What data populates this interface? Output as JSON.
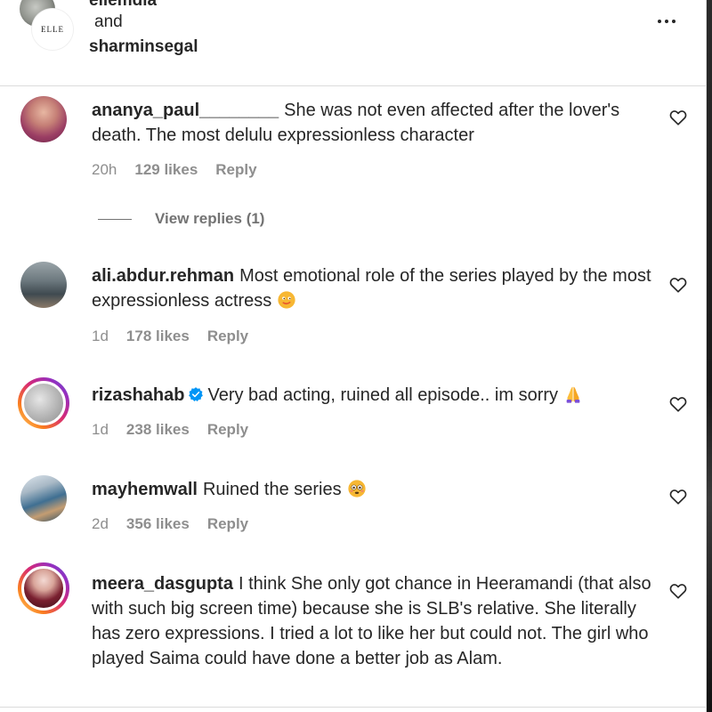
{
  "header": {
    "user1": "ellemdia",
    "and": "and",
    "user2": "sharminsegal",
    "logo_text": "ELLE"
  },
  "colors": {
    "text": "#262626",
    "secondary": "#8e8e8e",
    "verified": "#0095f6",
    "border": "#dbdbdb"
  },
  "comments": [
    {
      "username": "ananya_paul________",
      "text": "She was not even affected after the lover's death. The most delulu expressionless character",
      "time": "20h",
      "likes": "129 likes",
      "reply": "Reply",
      "view_replies": "View replies (1)"
    },
    {
      "username": "ali.abdur.rehman",
      "text": "Most emotional role of the series played by the most expressionless actress",
      "emoji": "smirk-face",
      "time": "1d",
      "likes": "178 likes",
      "reply": "Reply"
    },
    {
      "username": "rizashahab",
      "verified": true,
      "text": "Very bad acting, ruined all episode.. im sorry",
      "emoji": "folded-hands",
      "time": "1d",
      "likes": "238 likes",
      "reply": "Reply"
    },
    {
      "username": "mayhemwall",
      "text": "Ruined the series",
      "emoji": "flushed-face",
      "time": "2d",
      "likes": "356 likes",
      "reply": "Reply"
    },
    {
      "username": "meera_dasgupta",
      "text": "I think She only got chance in Heeramandi (that also with such big screen time) because she is SLB's relative. She literally has zero expressions. I tried a lot to like her but could not. The girl who played Saima could have done a better job as Alam."
    }
  ]
}
